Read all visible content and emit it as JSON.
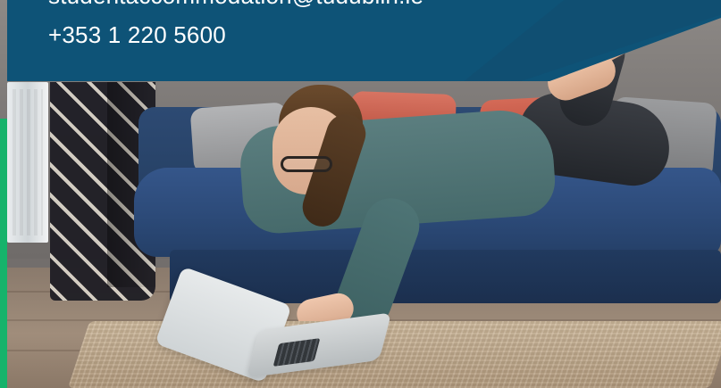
{
  "overlay": {
    "contact": {
      "email": "studentaccommodation@tudublin.ie",
      "phone": "+353 1 220 5600"
    }
  },
  "colors": {
    "banner_primary": "#0e5377",
    "banner_accent": "#124d70",
    "green_accent": "#16b36b",
    "text": "#ffffff"
  },
  "scene": {
    "photo_subject": "person-lying-on-sofa-using-laptop"
  }
}
